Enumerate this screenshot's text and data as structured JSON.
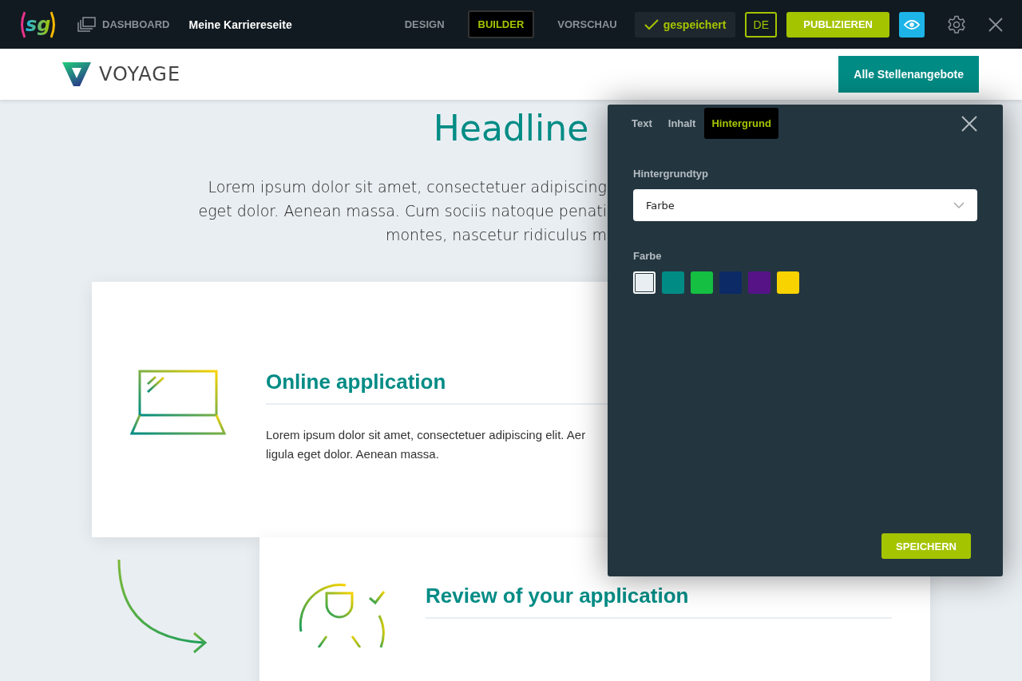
{
  "topbar": {
    "logo": "sg",
    "dashboard": "DASHBOARD",
    "site_name": "Meine Karriereseite",
    "modes": [
      {
        "label": "DESIGN",
        "selected": false
      },
      {
        "label": "BUILDER",
        "selected": true
      },
      {
        "label": "VORSCHAU",
        "selected": false
      }
    ],
    "status": "gespeichert",
    "language": "DE",
    "publish": "PUBLIZIEREN"
  },
  "site_header": {
    "brand": "VOYAGE",
    "cta": "Alle Stellenangebote"
  },
  "headline": "Headline",
  "intro_lines": [
    "Lorem ipsum dolor sit amet, consectetuer adipiscing",
    "eget dolor. Aenean massa. Cum sociis natoque penati",
    "montes, nascetur ridiculus m"
  ],
  "steps": [
    {
      "kind": "laptop",
      "title": "Online application",
      "lines": [
        "Lorem ipsum dolor sit amet, consectetuer adipiscing elit. Aer",
        "ligula eget dolor. Aenean massa."
      ]
    },
    {
      "kind": "review",
      "title": "Review of your application"
    }
  ],
  "panel": {
    "tabs": [
      {
        "label": "Text",
        "selected": false
      },
      {
        "label": "Inhalt",
        "selected": false
      },
      {
        "label": "Hintergrund",
        "selected": true
      }
    ],
    "type_label": "Hintergrundtyp",
    "type_value": "Farbe",
    "color_label": "Farbe",
    "swatches": [
      {
        "color": "#e9eef2",
        "selected": true
      },
      {
        "color": "#008c85",
        "selected": false
      },
      {
        "color": "#14bf41",
        "selected": false
      },
      {
        "color": "#0b2a66",
        "selected": false
      },
      {
        "color": "#551385",
        "selected": false
      },
      {
        "color": "#f8d300",
        "selected": false
      }
    ],
    "save": "SPEICHERN"
  }
}
